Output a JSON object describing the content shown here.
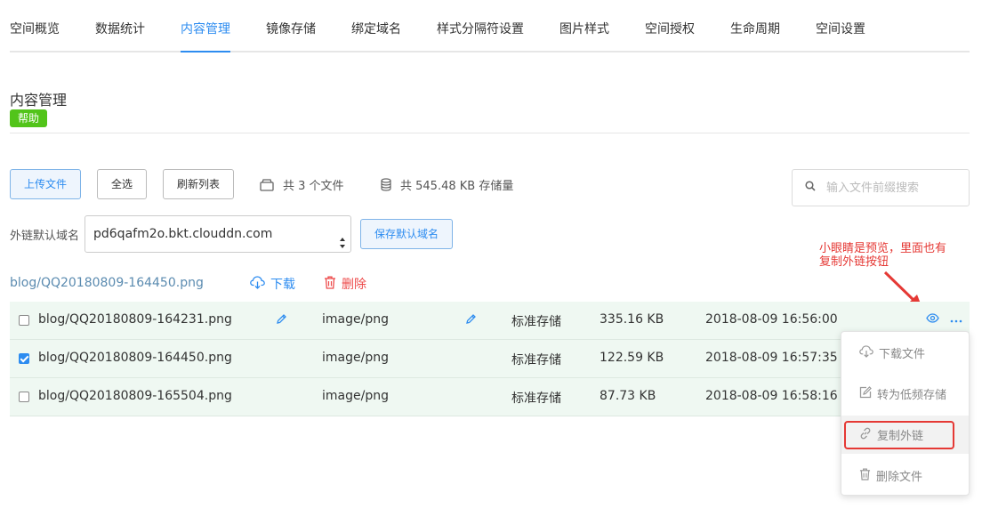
{
  "tabs": [
    {
      "label": "空间概览"
    },
    {
      "label": "数据统计"
    },
    {
      "label": "内容管理"
    },
    {
      "label": "镜像存储"
    },
    {
      "label": "绑定域名"
    },
    {
      "label": "样式分隔符设置"
    },
    {
      "label": "图片样式"
    },
    {
      "label": "空间授权"
    },
    {
      "label": "生命周期"
    },
    {
      "label": "空间设置"
    }
  ],
  "active_tab": "内容管理",
  "page": {
    "title": "内容管理",
    "help_label": "帮助"
  },
  "toolbar": {
    "upload_label": "上传文件",
    "select_all_label": "全选",
    "refresh_label": "刷新列表",
    "file_count_text": "共 3 个文件",
    "storage_text": "共 545.48 KB 存储量",
    "search_placeholder": "输入文件前缀搜索"
  },
  "domain": {
    "label": "外链默认域名",
    "selected": "pd6qafm2o.bkt.clouddn.com",
    "save_label": "保存默认域名"
  },
  "selection_bar": {
    "selected_file": "blog/QQ20180809-164450.png",
    "download_label": "下载",
    "delete_label": "删除"
  },
  "annotation": {
    "line1": "小眼睛是预览，里面也有",
    "line2": "复制外链按钮"
  },
  "files": [
    {
      "name": "blog/QQ20180809-164231.png",
      "type": "image/png",
      "storage": "标准存储",
      "size": "335.16 KB",
      "time": "2018-08-09 16:56:00",
      "checked": false
    },
    {
      "name": "blog/QQ20180809-164450.png",
      "type": "image/png",
      "storage": "标准存储",
      "size": "122.59 KB",
      "time": "2018-08-09 16:57:35",
      "checked": true
    },
    {
      "name": "blog/QQ20180809-165504.png",
      "type": "image/png",
      "storage": "标准存储",
      "size": "87.73 KB",
      "time": "2018-08-09 16:58:16",
      "checked": false
    }
  ],
  "menu": {
    "download": "下载文件",
    "to_low_freq": "转为低频存储",
    "copy_link": "复制外链",
    "delete_file": "删除文件"
  },
  "colors": {
    "accent": "#2d8cf0",
    "help_green": "#52c41a",
    "danger": "#ed4a4a",
    "annotation_red": "#e53935",
    "row_bg": "#eff8f2"
  },
  "icons": {
    "stat_files": "box-icon",
    "stat_storage": "database-icon",
    "search": "search-icon",
    "download": "cloud-download-icon",
    "delete": "trash-icon",
    "edit": "pencil-icon",
    "preview": "eye-icon",
    "more": "more-dots-icon",
    "menu_download": "cloud-download-icon",
    "menu_low_freq": "edit-square-icon",
    "menu_copy": "link-icon",
    "menu_delete": "trash-icon"
  }
}
